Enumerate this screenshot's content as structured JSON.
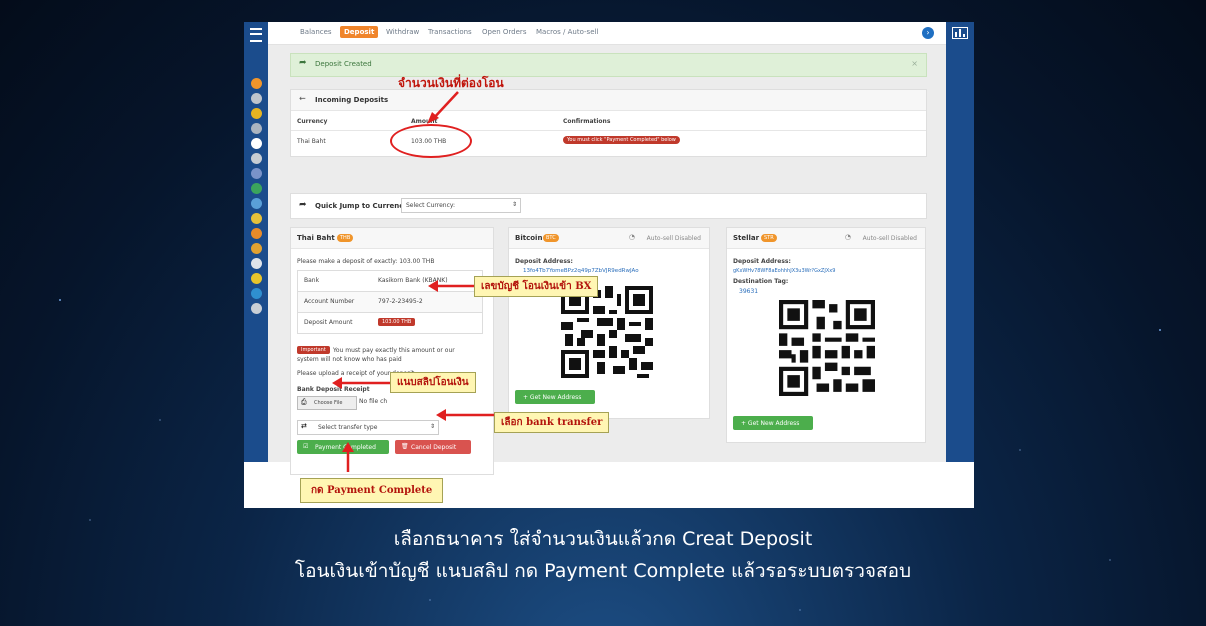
{
  "nav": {
    "items": [
      "Balances",
      "Deposit",
      "Withdraw",
      "Transactions",
      "Open Orders",
      "Macros / Auto-sell"
    ]
  },
  "alert": {
    "text": "Deposit Created",
    "close": "×"
  },
  "incoming": {
    "title": "Incoming Deposits",
    "headers": [
      "Currency",
      "Amount",
      "Confirmations"
    ],
    "row": {
      "currency": "Thai Baht",
      "amount": "103.00 THB",
      "confirm": "You must click \"Payment Completed\" below"
    }
  },
  "jump": {
    "label": "Quick Jump to Currency:",
    "select": "Select Currency:"
  },
  "thb": {
    "title": "Thai Baht",
    "tag": "THB",
    "instruction": "Please make a deposit of exactly: 103.00 THB",
    "rows": [
      {
        "k": "Bank",
        "v": "Kasikorn Bank (KBANK)"
      },
      {
        "k": "Account Number",
        "v": "797-2-23495-2"
      },
      {
        "k": "Deposit Amount",
        "v": "103.00 THB"
      }
    ],
    "important_tag": "Important",
    "important_text": "You must pay exactly this amount or our system will not know who has paid",
    "upload_text": "Please upload a receipt of your deposit",
    "receipt_label": "Bank Deposit Receipt",
    "choose_file": "Choose File",
    "no_file": "No file ch",
    "transfer_select": "Select transfer type",
    "btn_complete": "Payment Completed",
    "btn_cancel": "Cancel Deposit"
  },
  "btc": {
    "title": "Bitcoin",
    "tag": "BTC",
    "autosell": "Auto-sell Disabled",
    "addr_label": "Deposit Address:",
    "addr": "13fo4Tb7YomeBPz2q49p7ZbVJR9edRwJAo",
    "btn": "+ Get New Address"
  },
  "xlm": {
    "title": "Stellar",
    "tag": "STR",
    "autosell": "Auto-sell Disabled",
    "addr_label": "Deposit Address:",
    "addr": "gKxWHv78WF8aEohhhJX3u3Wr?GxZJXx9",
    "dest_label": "Destination Tag:",
    "dest": "39631",
    "btn": "+ Get New Address"
  },
  "callouts": {
    "amount": "จำนวนเงินที่ต่องโอน",
    "account": "เลขบัญชี โอนเงินเข้า BX",
    "slip": "แนบสลิปโอนเงิน",
    "transfer": "เลือก bank transfer",
    "payment": "กด Payment Complete"
  },
  "caption": {
    "line1": "เลือกธนาคาร ใส่จำนวนเงินแล้วกด Creat Deposit",
    "line2": "โอนเงินเข้าบัญชี แนบสลิป กด Payment Complete แล้วรอระบบตรวจสอบ"
  },
  "colors": {
    "accent": "#f0852b",
    "sidebar": "#1b4c8c",
    "green": "#4cae4c",
    "red": "#d9534f"
  }
}
